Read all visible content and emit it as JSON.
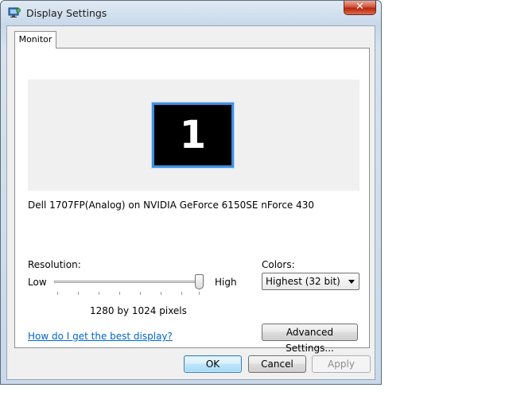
{
  "window": {
    "title": "Display Settings",
    "close_label": "✕"
  },
  "tabs": [
    {
      "label": "Monitor"
    }
  ],
  "preview": {
    "monitor_number": "1",
    "display_name": "Dell 1707FP(Analog) on NVIDIA GeForce 6150SE nForce 430"
  },
  "resolution": {
    "label": "Resolution:",
    "low_label": "Low",
    "high_label": "High",
    "value_text": "1280 by 1024 pixels",
    "slider_position": 1.0
  },
  "colors": {
    "label": "Colors:",
    "selected": "Highest (32 bit)"
  },
  "help_link": "How do I get the best display?",
  "advanced_button": "Advanced Settings...",
  "buttons": {
    "ok": "OK",
    "cancel": "Cancel",
    "apply": "Apply"
  }
}
